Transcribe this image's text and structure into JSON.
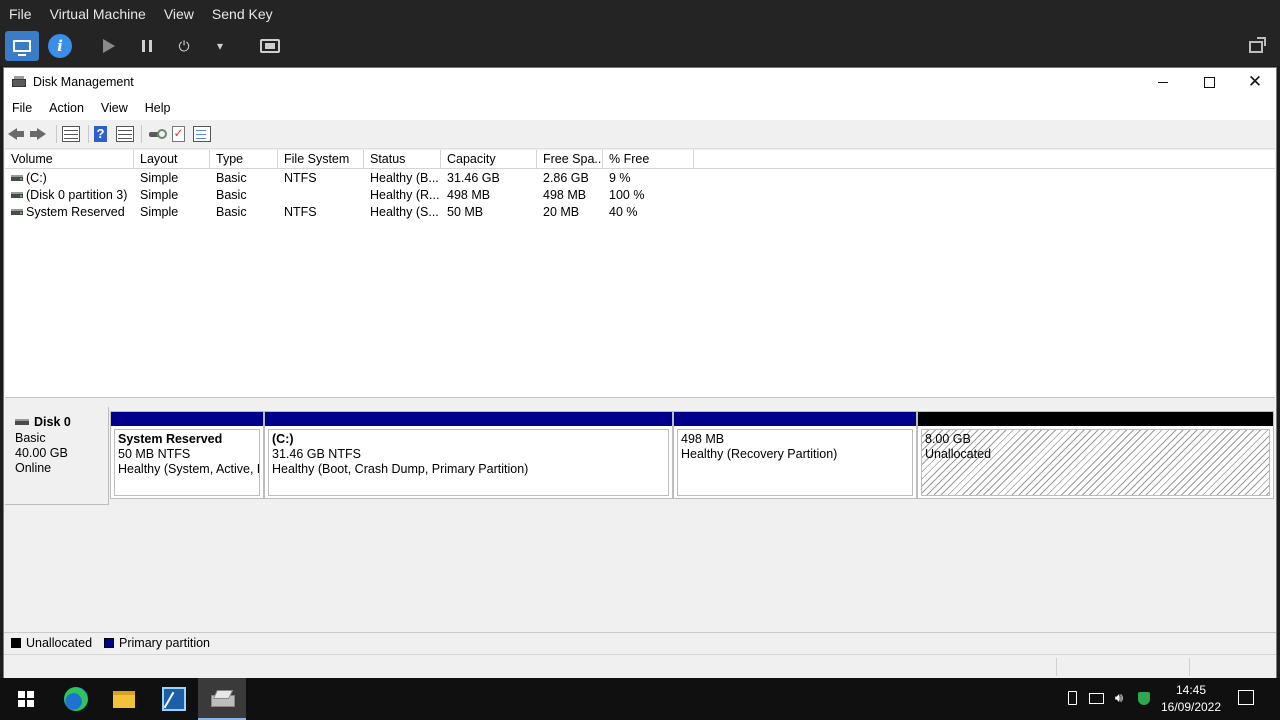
{
  "vm": {
    "menu": [
      "File",
      "Virtual Machine",
      "View",
      "Send Key"
    ]
  },
  "window": {
    "title": "Disk Management",
    "menu": [
      "File",
      "Action",
      "View",
      "Help"
    ]
  },
  "volume_list": {
    "columns": [
      "Volume",
      "Layout",
      "Type",
      "File System",
      "Status",
      "Capacity",
      "Free Spa...",
      "% Free"
    ],
    "rows": [
      [
        "(C:)",
        "Simple",
        "Basic",
        "NTFS",
        "Healthy (B...",
        "31.46 GB",
        "2.86 GB",
        "9 %"
      ],
      [
        "(Disk 0 partition 3)",
        "Simple",
        "Basic",
        "",
        "Healthy (R...",
        "498 MB",
        "498 MB",
        "100 %"
      ],
      [
        "System Reserved",
        "Simple",
        "Basic",
        "NTFS",
        "Healthy (S...",
        "50 MB",
        "20 MB",
        "40 %"
      ]
    ]
  },
  "disk": {
    "name": "Disk 0",
    "type": "Basic",
    "size": "40.00 GB",
    "status": "Online",
    "partitions": [
      {
        "name": "System Reserved",
        "size": "50 MB NTFS",
        "status": "Healthy (System, Active, P",
        "kind": "primary"
      },
      {
        "name": "(C:)",
        "size": "31.46 GB NTFS",
        "status": "Healthy (Boot, Crash Dump, Primary Partition)",
        "kind": "primary"
      },
      {
        "name": "",
        "size": "498 MB",
        "status": "Healthy (Recovery Partition)",
        "kind": "primary"
      },
      {
        "name": "",
        "size": "8.00 GB",
        "status": "Unallocated",
        "kind": "unallocated"
      }
    ]
  },
  "legend": {
    "unallocated": "Unallocated",
    "primary": "Primary partition"
  },
  "colors": {
    "primary": "#00008b",
    "unallocated": "#000000"
  },
  "taskbar": {
    "time": "14:45",
    "date": "16/09/2022",
    "apps": [
      "start-icon",
      "edge-icon",
      "file-explorer-icon",
      "ide-icon",
      "disk-management-icon"
    ]
  }
}
